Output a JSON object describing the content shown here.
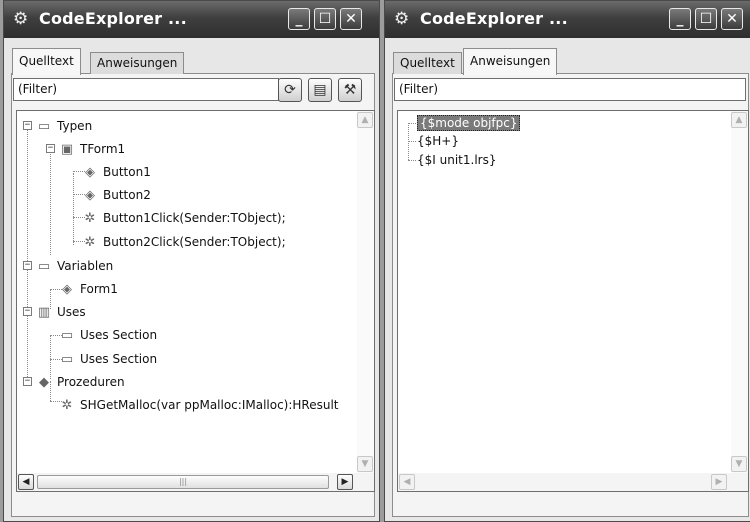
{
  "left": {
    "title": "CodeExplorer ...",
    "tabs": [
      "Quelltext",
      "Anweisungen"
    ],
    "filter": "(Filter)",
    "tree": [
      {
        "label": "Typen",
        "icon": "folder-icon"
      },
      {
        "label": "TForm1",
        "icon": "class-icon"
      },
      {
        "label": "Button1",
        "icon": "field-icon"
      },
      {
        "label": "Button2",
        "icon": "field-icon"
      },
      {
        "label": "Button1Click(Sender:TObject);",
        "icon": "method-icon"
      },
      {
        "label": "Button2Click(Sender:TObject);",
        "icon": "method-icon"
      },
      {
        "label": "Variablen",
        "icon": "folder-icon"
      },
      {
        "label": "Form1",
        "icon": "field-icon"
      },
      {
        "label": "Uses",
        "icon": "book-icon"
      },
      {
        "label": "Uses Section",
        "icon": "folder-icon"
      },
      {
        "label": "Uses Section",
        "icon": "folder-icon"
      },
      {
        "label": "Prozeduren",
        "icon": "procedure-icon"
      },
      {
        "label": "SHGetMalloc(var ppMalloc:IMalloc):HResult",
        "icon": "method-icon"
      }
    ]
  },
  "right": {
    "title": "CodeExplorer ...",
    "tabs": [
      "Quelltext",
      "Anweisungen"
    ],
    "filter": "(Filter)",
    "tree": [
      {
        "label": "{$mode objfpc}",
        "selected": true
      },
      {
        "label": "{$H+}"
      },
      {
        "label": "{$I unit1.lrs}"
      }
    ]
  },
  "glyphs": {
    "app": "⚙",
    "minimize": "_",
    "maximize": "☐",
    "close": "✕",
    "refresh": "⟳",
    "options": "▤",
    "settings": "⚒",
    "up": "▲",
    "down": "▼",
    "left": "◀",
    "right": "▶",
    "grip": "|||",
    "expand": "−"
  }
}
